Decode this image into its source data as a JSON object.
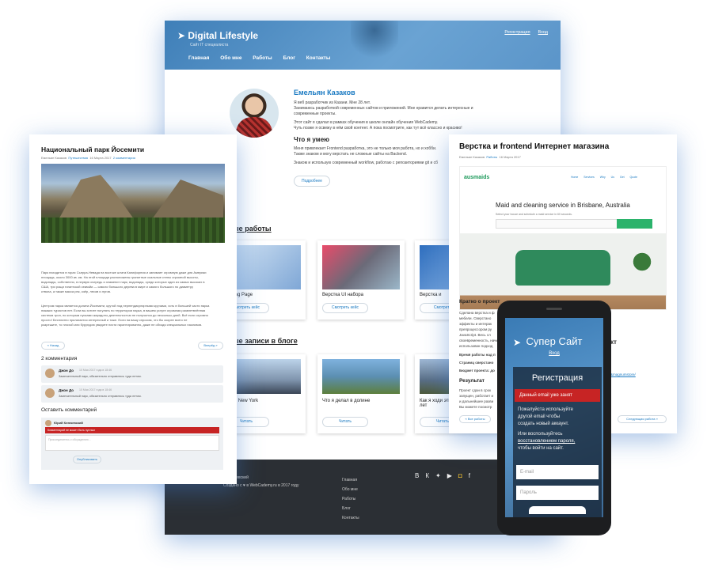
{
  "main": {
    "logo": "Digital Lifestyle",
    "tagline": "Сайт IT специалиста",
    "register": "Регистрация",
    "login": "Вход",
    "nav": [
      "Главная",
      "Обо мне",
      "Работы",
      "Блог",
      "Контакты"
    ],
    "name": "Емельян Казаков",
    "bio1": "Я веб разработчик из Казани. Мне 28 лет.",
    "bio2": "Занимаюсь разработкой современных сайтов и приложений. Мне нравится делать интересные и",
    "bio3": "современные проекты.",
    "bio4": "Этот сайт я сделал в рамках обучения в школе онлайн обучения WebCademy.",
    "bio5": "Чуть позже я освежу в нём свой контент. А пока посмотрите, как тут всё классно и красиво!",
    "skills_title": "Что я умею",
    "skills1": "Меня привлекает Frontend разработка, это не только моя работа, но и хобби.",
    "skills2": "Также знаком и могу верстать не сложные сайты на Backend.",
    "skills3": "Знаком и использую современный workflow, работаю с репозиториями git и сб",
    "more": "Подробнее",
    "works_title": "ые работы",
    "works": [
      {
        "title": "Landing Page",
        "btn": "Смотреть кейс"
      },
      {
        "title": "Верстка UI набора",
        "btn": "Смотреть кейс"
      },
      {
        "title": "Верстка и",
        "btn": "Смотреть"
      }
    ],
    "blog_title": "ые записи в блоге",
    "posts": [
      {
        "title": "здка в New York",
        "btn": "Читать"
      },
      {
        "title": "Что я делал в долине",
        "btn": "Читать"
      },
      {
        "title": "Как я ходи этим лет",
        "btn": "Читать"
      }
    ],
    "footer_name": "н Ключевский",
    "footer_made": "Создано с ♥ в WebCademy.ru в 2017 году",
    "footer_nav": [
      "Главная",
      "Обо мне",
      "Работы",
      "Блог",
      "Контакты"
    ],
    "social": [
      "vk-icon",
      "twitter-icon",
      "youtube-icon",
      "instagram-icon",
      "facebook-icon"
    ]
  },
  "left": {
    "title": "Национальный парк Йосемити",
    "author": "Емельян Казаков",
    "category": "Путешествия",
    "date": "16 Марта 2017",
    "comments_link": "2 комментария",
    "text1": "Парк находится в горах Сьерра-Невада на востоке штата Калифорния и занимает огромную даже для Америки",
    "text2": "площадь, около 3000 кв. км. На этой площади расположены гранитные скальные стены огромной высоты,",
    "text3": "водопады, собственно, в первую очередь и знаменит парк, водопады, среди которых один из самых высоких в",
    "text4": "США, три рощи гигантской секвойи — самого большого дерева в мире и самого большого по диаметру",
    "text5": "ствола, а также масса рек, озёр, лесов и лугов.",
    "text6": "Центром парка является долина Йосемити, крутой под перпендикулярными кручами, хоть в большей части парка",
    "text7": "никаких туристов нет. Если вы хотите погулять по территории парка, в вашем услуге огромная развлетвлённая",
    "text8": "система троп, по которым пусками жарадоты деятельностью не получился до несколько дней. Всё если огромно",
    "text9": "просто! Бесплатно прилагается интересный и тоже. Если на вашу спросим, что бы скорее всего не",
    "text10": "разрешите, то плохой или бурундою увидите почти гарантированно, даже не обходя специальных наоливов.",
    "prev": "« Назад",
    "next": "Вперёд »",
    "comments_title": "2 комментария",
    "comments": [
      {
        "name": "Джон До",
        "date": "10 Мая 2017 года в 18:46",
        "text": "Замечательный парк, обязательно отправлюсь туда летом."
      },
      {
        "name": "Джон До",
        "date": "10 Мая 2017 года в 18:46",
        "text": "Замечательный парк, обязательно отправлюсь туда летом."
      }
    ],
    "leave": "Оставить комментарий",
    "commenter": "Юрий Ключевский",
    "error": "Комментарий не может быть пустым",
    "placeholder": "Присоединитесь к обсуждению...",
    "publish": "Опубликовать"
  },
  "right": {
    "title": "Верстка и frontend Интернет магазина",
    "author": "Емельян Казаков",
    "category": "Работы",
    "date": "16 Марта 2017",
    "shot_logo": "ausmaids",
    "shot_nav": "Home Services Why Us Get Quote",
    "shot_heading": "Maid and cleaning service in Brisbane, Australia",
    "shot_sub": "Select your house and schedule a maid service in 60 seconds.",
    "short_title": "Кратко о проект",
    "p1": "Сделана верстка и ф",
    "p2": "мебели. Сверстано",
    "p3": "эффекты и интерак",
    "p4": "препроцессором ру",
    "p5": "JavaScript. Весь сл",
    "p6": "своевременность, начи",
    "p7": "использован подход",
    "k1": "Время работы над п",
    "k2": "Страниц сверстано",
    "k3": "Бюджет проекта: до",
    "result": "Результат",
    "r1": "Проект сдан в срок",
    "r2": "запущен, работает и",
    "r3": "и дальнейшее разви",
    "r4": "Вы можете посмотр",
    "side1": "кт",
    "side2": "&magnumstore/",
    "all": "« Все работы",
    "nextwork": "Следующая работа »"
  },
  "phone": {
    "brand": "Супер Сайт",
    "enter": "Вход",
    "reg": "Регистрация",
    "error": "Данный email уже занят",
    "msg1": "Пожалуйста используйте",
    "msg2": "другой email чтобы",
    "msg3": "создать новый аккаунт.",
    "msg4": "Или воспользуйтесь",
    "msg5": "восстановлением пароля,",
    "msg6": "чтобы войти на сайт.",
    "email_ph": "E-mail",
    "pass_ph": "Пароль"
  }
}
